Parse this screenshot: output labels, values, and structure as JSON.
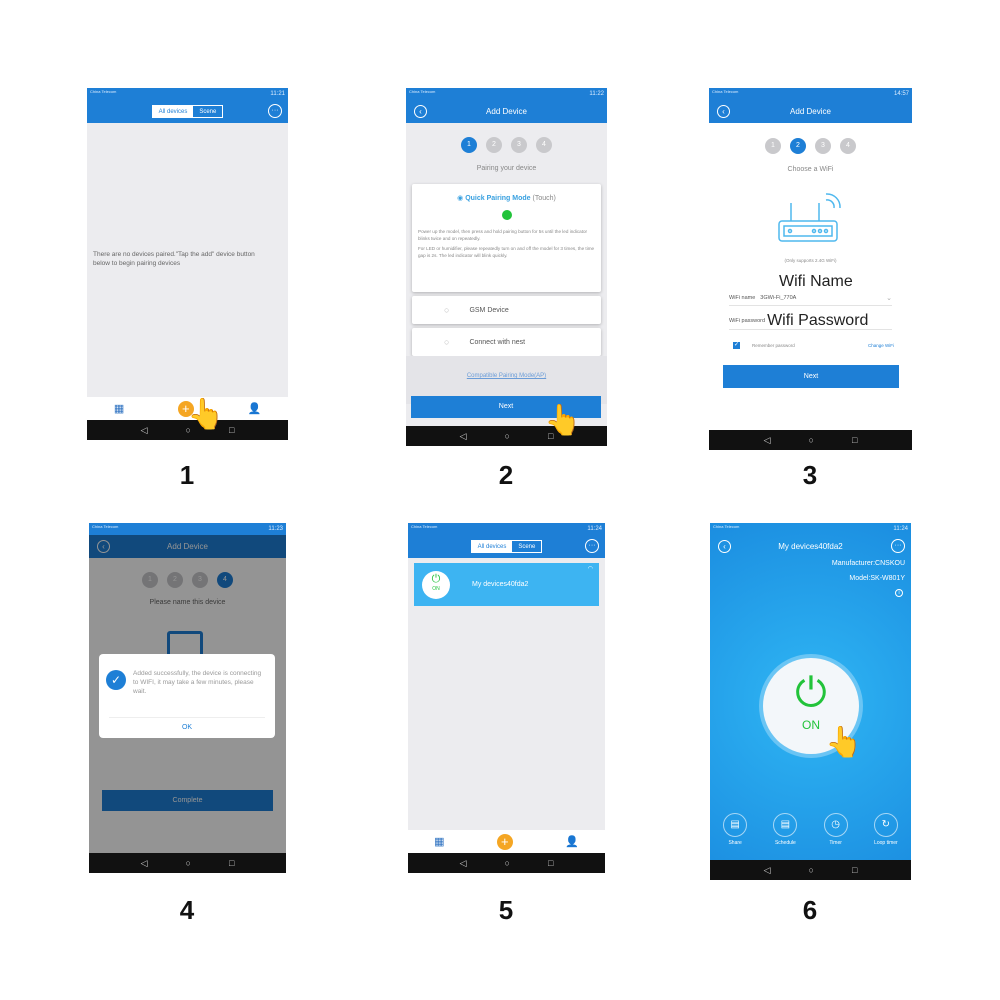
{
  "labels": [
    "1",
    "2",
    "3",
    "4",
    "5",
    "6"
  ],
  "colors": {
    "primary": "#1e7fd6",
    "accent": "#f5a623",
    "on_green": "#22c33a",
    "device_card": "#3db4f2"
  },
  "status": {
    "carrier1": "China Telecom",
    "carrier2": "China Mobile",
    "times": [
      "11:21",
      "11:22",
      "14:57",
      "11:23",
      "11:24",
      "11:24"
    ]
  },
  "home": {
    "all_devices": "All devices",
    "scene": "Scene",
    "empty_message": "There are no devices paired.\"Tap the add\" device button below to begin pairing devices",
    "more_icon": "more-icon",
    "device_name": "My devices40fda2",
    "device_state": "ON"
  },
  "nav": {
    "back": "◁",
    "home": "○",
    "recent": "□"
  },
  "step2": {
    "title": "Add Device",
    "steps": [
      "1",
      "2",
      "3",
      "4"
    ],
    "subtitle": "Pairing your device",
    "quick_mode": "Quick Pairing Mode",
    "quick_mode_suffix": "(Touch)",
    "desc1": "Power up the model, then press and hold pairing button for 5s until the led indicator blinks twice and on repeatedly.",
    "desc2": "For LED or humidifier, please repeatedly turn on and off the model for 3 times, the time gap is 2s. The led indicator will blink quickly.",
    "gsm": "GSM Device",
    "nest": "Connect with nest",
    "compat": "Compatible Pairing Mode(AP)",
    "next": "Next"
  },
  "step3": {
    "title": "Add Device",
    "subtitle": "Choose a WiFi",
    "support": "(Only supports 2.4G WiFi)",
    "wifi_name_overlay": "Wifi Name",
    "wifi_name_label": "WiFi name",
    "wifi_name_value": "3GWi-Fi_770A",
    "wifi_pw_label": "WiFi password",
    "wifi_pw_overlay": "Wifi Password",
    "remember": "Remember password",
    "change": "Change WiFi",
    "next": "Next"
  },
  "step4": {
    "title": "Add Device",
    "subtitle": "Please name this device",
    "dialog": "Added successfully, the device is connecting to WIFI, it may take a few minutes, please wait.",
    "ok": "OK",
    "complete": "Complete"
  },
  "device": {
    "title": "My devices40fda2",
    "manufacturer": "Manufacturer:CNSKOU",
    "model": "Model:SK-W801Y",
    "state": "ON",
    "actions": [
      "Share",
      "Schedule",
      "Timer",
      "Loop timer"
    ]
  }
}
